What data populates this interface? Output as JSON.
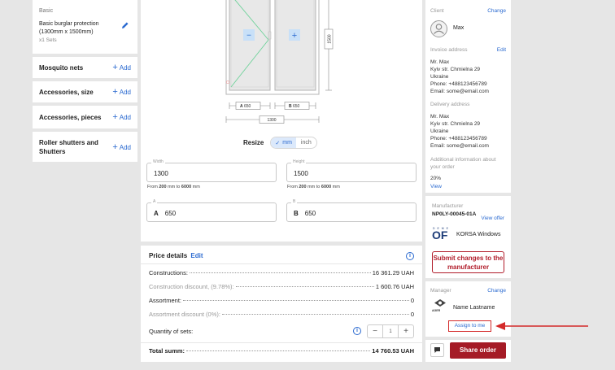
{
  "left": {
    "basic": {
      "section": "Basic",
      "name": "Basic burglar protection (1300mm x 1500mm)",
      "qty": "x1 Sets"
    },
    "rows": [
      {
        "label": "Mosquito nets",
        "add": "Add"
      },
      {
        "label": "Accessories, size",
        "add": "Add"
      },
      {
        "label": "Accessories, pieces",
        "add": "Add"
      },
      {
        "label": "Roller shutters and Shutters",
        "add": "Add"
      }
    ]
  },
  "drawing": {
    "height_dim": "1500",
    "sash_a_dim": "650",
    "sash_b_dim": "650",
    "total_width_dim": "1300",
    "sash_a_letter": "A",
    "sash_b_letter": "B",
    "minus_symbol": "−",
    "plus_symbol": "+",
    "frame_color": "#b5b5b5",
    "glass_color": "#e8e8e8",
    "opening_line_color": "#6ed29a"
  },
  "resize": {
    "label": "Resize",
    "mm": "mm",
    "inch": "inch",
    "check": "✓"
  },
  "fields": {
    "width": {
      "legend": "Width",
      "value": "1300",
      "hint_pre": "From ",
      "min": "200",
      "hint_mid": " mm to ",
      "max": "6000",
      "hint_post": " mm"
    },
    "height": {
      "legend": "Height",
      "value": "1500",
      "hint_pre": "From ",
      "min": "200",
      "hint_mid": " mm to ",
      "max": "6000",
      "hint_post": " mm"
    },
    "a": {
      "legend": "A",
      "prefix": "A",
      "value": "650"
    },
    "b": {
      "legend": "B",
      "prefix": "B",
      "value": "650"
    }
  },
  "price": {
    "title": "Price details",
    "edit": "Edit",
    "info_glyph": "i",
    "rows": [
      {
        "label": "Constructions:",
        "value": "16 361.29 UAH"
      },
      {
        "label": "Construction discount, (9.78%):",
        "value": "1 600.76 UAH"
      },
      {
        "label": "Assortment:",
        "value": "0"
      },
      {
        "label": "Assortment discount (0%):",
        "value": "0"
      }
    ],
    "quantity_label": "Quantity of sets:",
    "quantity_value": "1",
    "minus": "−",
    "plus": "+",
    "total_label": "Total summ:",
    "total_value": "14 760.53 UAH"
  },
  "client": {
    "title": "Client",
    "change": "Change",
    "name": "Max",
    "invoice_title": "Invoice address",
    "invoice_edit": "Edit",
    "invoice_lines": [
      "Mr. Max",
      "Kyiv str. Chmielna 29",
      "Ukraine",
      "Phone: +488123456789",
      "Email: some@email.com"
    ],
    "delivery_title": "Delivery address",
    "delivery_lines": [
      "Mr. Max",
      "Kyiv str. Chmielna 29",
      "Ukraine",
      "Phone: +488123456789",
      "Email: some@email.com"
    ],
    "additional_title": "Additional information about your order",
    "additional_value": "20%",
    "view": "View"
  },
  "manufacturer": {
    "title": "Manufacturer",
    "code": "NP0LY-00045-01A",
    "view_offer": "View offer",
    "logo_text": "OF",
    "logo_small": "D E M E",
    "company": "KORSA Windows",
    "submit": "Submit changes to the manufacturer"
  },
  "manager": {
    "title": "Manager",
    "change": "Change",
    "logo_small": "AGER",
    "name": "Name Lastname",
    "assign": "Assign to me"
  },
  "footer": {
    "share": "Share order"
  },
  "colors": {
    "accent": "#2b6ad0",
    "brand": "#a51b26",
    "annotation": "#d42a2a"
  }
}
